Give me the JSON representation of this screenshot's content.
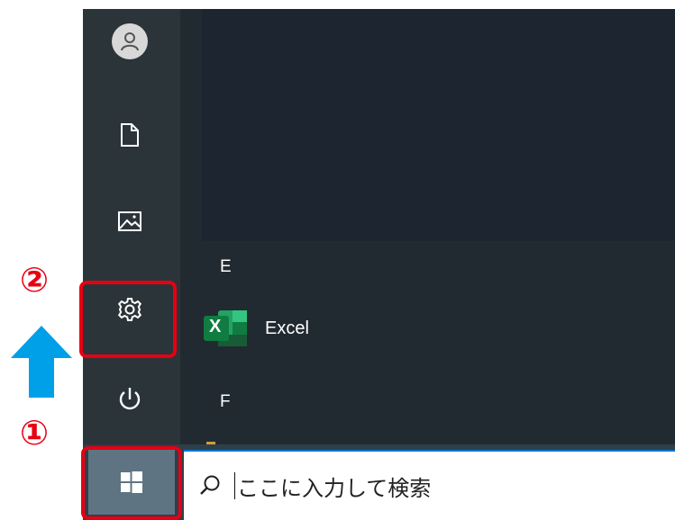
{
  "start_menu": {
    "rail_items": [
      {
        "icon": "user-icon"
      },
      {
        "icon": "document-icon"
      },
      {
        "icon": "pictures-icon"
      },
      {
        "icon": "settings-gear-icon"
      },
      {
        "icon": "power-icon"
      }
    ],
    "section_e": "E",
    "section_f": "F",
    "apps": [
      {
        "label": "Excel",
        "icon": "excel-icon",
        "badge": "X"
      }
    ]
  },
  "taskbar": {
    "start_icon": "windows-logo-icon",
    "search_icon": "search-icon",
    "search_placeholder": "ここに入力して検索"
  },
  "annotations": {
    "step1": "①",
    "step2": "②",
    "arrow": "up-arrow-icon",
    "highlight_color": "#e60012",
    "arrow_color": "#00a0e9"
  },
  "colors": {
    "rail_bg": "#2b3438",
    "tiles_bg": "#1c2530",
    "taskbar_bg": "#2f3f4a",
    "excel_green": "#107c41"
  }
}
